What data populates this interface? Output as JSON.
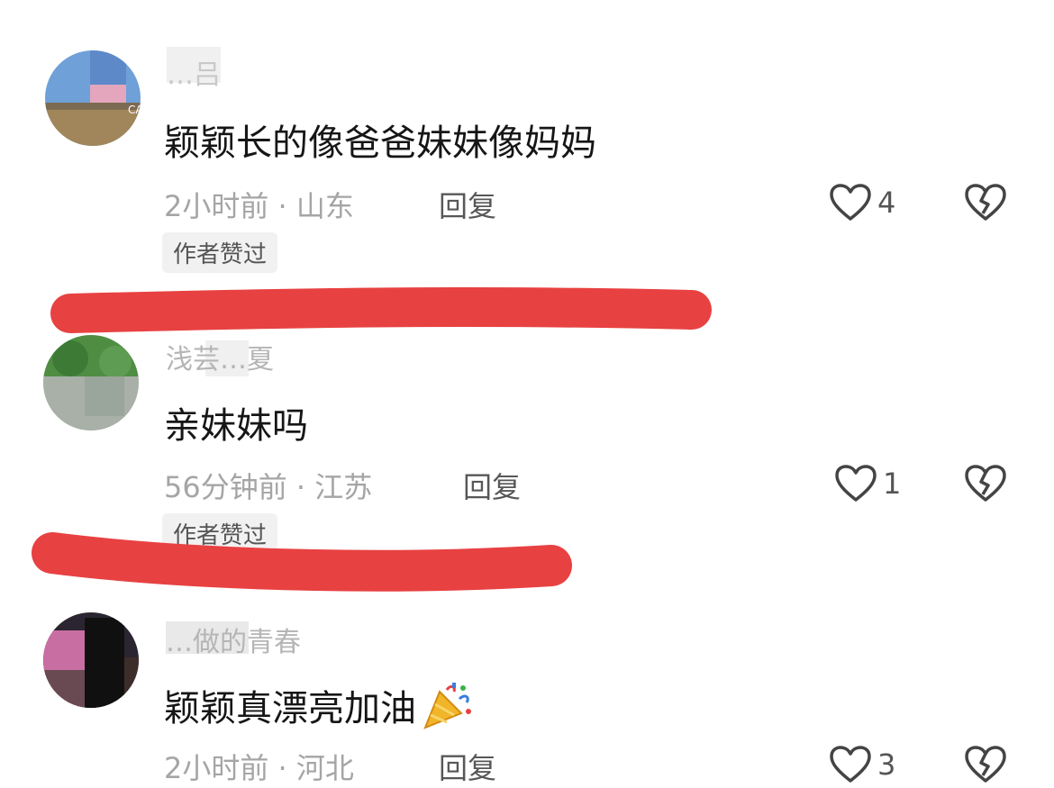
{
  "comments": [
    {
      "username": "…吕",
      "text": "颖颖长的像爸爸妹妹像妈妈",
      "time": "2小时前",
      "separator": "·",
      "location": "山东",
      "reply_label": "回复",
      "like_count": "4",
      "badge": "作者赞过"
    },
    {
      "username": "浅芸…夏",
      "text": "亲妹妹吗",
      "time": "56分钟前",
      "separator": "·",
      "location": "江苏",
      "reply_label": "回复",
      "like_count": "1",
      "badge": "作者赞过"
    },
    {
      "username": "…做的青春",
      "text": "颖颖真漂亮加油",
      "time": "2小时前",
      "separator": "·",
      "location": "河北",
      "reply_label": "回复",
      "like_count": "3",
      "emoji": "party-popper-icon"
    }
  ],
  "colors": {
    "annotation_red": "#e84141",
    "meta_gray": "#a5a5a5",
    "badge_bg": "#f1f1f1"
  }
}
